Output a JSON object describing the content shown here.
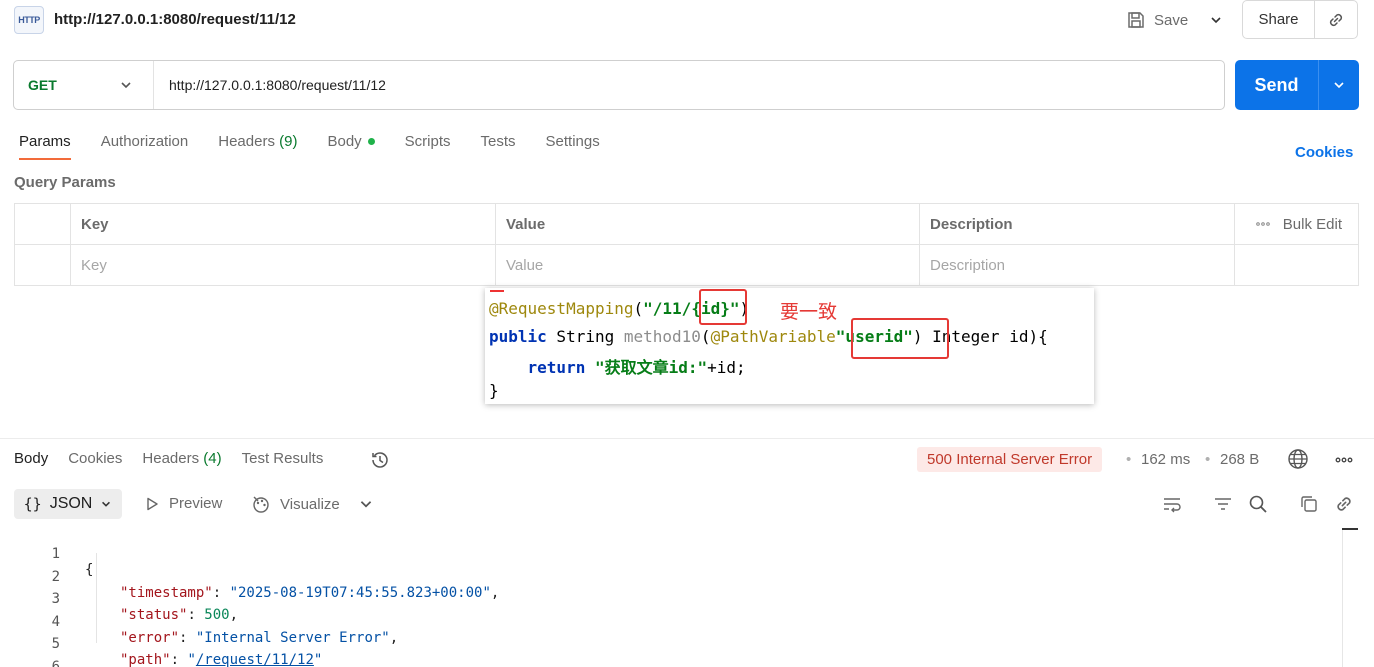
{
  "header": {
    "title": "http://127.0.0.1:8080/request/11/12",
    "http_icon_text": "HTTP",
    "save_label": "Save",
    "share_label": "Share"
  },
  "request": {
    "method": "GET",
    "url": "http://127.0.0.1:8080/request/11/12",
    "send_label": "Send"
  },
  "request_tabs": {
    "params": "Params",
    "authorization": "Authorization",
    "headers": "Headers",
    "headers_count": "(9)",
    "body": "Body",
    "scripts": "Scripts",
    "tests": "Tests",
    "settings": "Settings"
  },
  "cookies_link": "Cookies",
  "query_params": {
    "label": "Query Params",
    "columns": [
      "Key",
      "Value",
      "Description"
    ],
    "bulk_edit": "Bulk Edit",
    "placeholders": {
      "key": "Key",
      "value": "Value",
      "description": "Description"
    }
  },
  "code_overlay": {
    "line1": {
      "anno": "@RequestMapping",
      "open": "(",
      "str_a": "\"/11/",
      "str_b": "{id}",
      "str_c": "\"",
      "close": ")"
    },
    "line2": {
      "kw": "public",
      "type": " String ",
      "method": "method10",
      "paren": "(",
      "anno": "@PathVariable",
      "str": "\"userid\"",
      "rest": ") Integer id){"
    },
    "line3": {
      "indent": "    ",
      "kw": "return",
      "space": " ",
      "str": "\"获取文章id:\"",
      "rest": "+id;"
    },
    "line4": "}",
    "note": "要一致"
  },
  "response": {
    "tabs": {
      "body": "Body",
      "cookies": "Cookies",
      "headers": "Headers",
      "headers_count": "(4)",
      "test_results": "Test Results"
    },
    "status": "500 Internal Server Error",
    "time": "162 ms",
    "size": "268 B",
    "format": "JSON",
    "preview": "Preview",
    "visualize": "Visualize",
    "body_lines": [
      {
        "n": "1",
        "text": "{"
      },
      {
        "n": "2",
        "key": "\"timestamp\"",
        "value": "\"2025-08-19T07:45:55.823+00:00\""
      },
      {
        "n": "3",
        "key": "\"status\"",
        "value": "500"
      },
      {
        "n": "4",
        "key": "\"error\"",
        "value": "\"Internal Server Error\""
      },
      {
        "n": "5",
        "key": "\"path\"",
        "value_q1": "\"",
        "value_link": "/request/11/12",
        "value_q2": "\""
      },
      {
        "n": "6",
        "text": "}"
      }
    ]
  },
  "colors": {
    "accent": "#f26b3a",
    "send": "#0c73e8",
    "method_get": "#0a7a2e",
    "error_badge_bg": "#fde9e7",
    "error_badge_text": "#c0392b",
    "highlight_box": "#e53935"
  },
  "icons": [
    "http-icon",
    "save-icon",
    "chevron-down-icon",
    "link-icon",
    "history-icon",
    "globe-icon",
    "more-icon",
    "braces-icon",
    "play-icon",
    "visualize-icon",
    "wrap-icon",
    "filter-icon",
    "search-icon",
    "copy-icon"
  ]
}
